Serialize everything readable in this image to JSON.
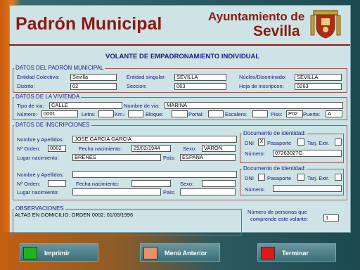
{
  "header": {
    "title": "Padrón Municipal",
    "org_line1": "Ayuntamiento de",
    "org_line2": "Sevilla",
    "subtitle": "VOLANTE DE EMPADRONAMIENTO INDIVIDUAL"
  },
  "padron": {
    "group_title": "DATOS DEL PADRÓN MUNICIPAL",
    "entidad_colectiva_label": "Entidad Colectiva:",
    "entidad_colectiva": "Sevilla",
    "entidad_singular_label": "Entidad singular:",
    "entidad_singular": "SEVILLA",
    "nucleo_label": "Núcleo/Diseminado:",
    "nucleo": "SEVILLA",
    "distrito_label": "Distrito:",
    "distrito": "02",
    "seccion_label": "Seccion:",
    "seccion": "063",
    "hoja_label": "Hoja de inscripcon:",
    "hoja": "0263"
  },
  "vivienda": {
    "group_title": "DATOS DE LA VIVIENDA",
    "tipo_via_label": "Tipo de via:",
    "tipo_via": "CALLE",
    "nombre_via_label": "Nombre de via:",
    "nombre_via": "MARINA",
    "numero_label": "Número:",
    "numero": "0001",
    "letra_label": "Letra:",
    "letra": "",
    "km_label": "Km.:",
    "km": "",
    "bloque_label": "Bloque:",
    "bloque": "",
    "portal_label": "Portal:",
    "portal": "",
    "escalera_label": "Escalera:",
    "escalera": "",
    "piso_label": "Piso:",
    "piso": "P02",
    "puerta_label": "Puerta:",
    "puerta": "A"
  },
  "inscripciones": {
    "group_title": "DATOS DE INSCRIPCIONES",
    "persons": [
      {
        "nombre_label": "Nombre y Apellidos:",
        "nombre": "JOSE GARCIA GARCIA",
        "orden_label": "Nº Orden:",
        "orden": "0002",
        "fecha_label": "Fecha nacimiento:",
        "fecha": "25/02/1944",
        "sexo_label": "Sexo:",
        "sexo": "VARON",
        "lugar_label": "Lugar nacimiento:",
        "lugar": "BRENES",
        "pais_label": "País:",
        "pais": "ESPAÑA",
        "doc_title": "Documento de identidad:",
        "dni_label": "DNI",
        "dni_checked": "X",
        "pasaporte_label": "Pasaporte",
        "pasaporte_checked": "",
        "tarj_label": "Tarj. Extr.",
        "tarj_checked": "",
        "numero_label": "Número:",
        "numero": "07263027G"
      },
      {
        "nombre_label": "Nombre y Apellidos:",
        "nombre": "",
        "orden_label": "Nº Orden:",
        "orden": "",
        "fecha_label": "Fecha nacimiento:",
        "fecha": "",
        "sexo_label": "Sexo:",
        "sexo": "",
        "lugar_label": "Lugar nacimiento:",
        "lugar": "",
        "pais_label": "País:",
        "pais": "",
        "doc_title": "Documento de identidad:",
        "dni_label": "DNI",
        "dni_checked": "",
        "pasaporte_label": "Pasaporte",
        "pasaporte_checked": "",
        "tarj_label": "Tarj. Extr.",
        "tarj_checked": "",
        "numero_label": "Número:",
        "numero": ""
      }
    ]
  },
  "observaciones": {
    "group_title": "OBSERVACIONES",
    "text": "ALTAS EN DOMICILIO:  ORDEN 0002: 01/05/1996"
  },
  "personas": {
    "label_line1": "Número de personas que",
    "label_line2": "comprende este volante:",
    "value": "1"
  },
  "buttons": {
    "imprimir": "Imprimir",
    "menu": "Menú Anterior",
    "terminar": "Terminar"
  },
  "colors": {
    "imprimir_swatch": "#22b022",
    "menu_swatch": "#e8916a",
    "terminar_swatch": "#e01818",
    "brand_red": "#8b1a10"
  },
  "icons": {
    "crest": "coat-of-arms-icon"
  }
}
